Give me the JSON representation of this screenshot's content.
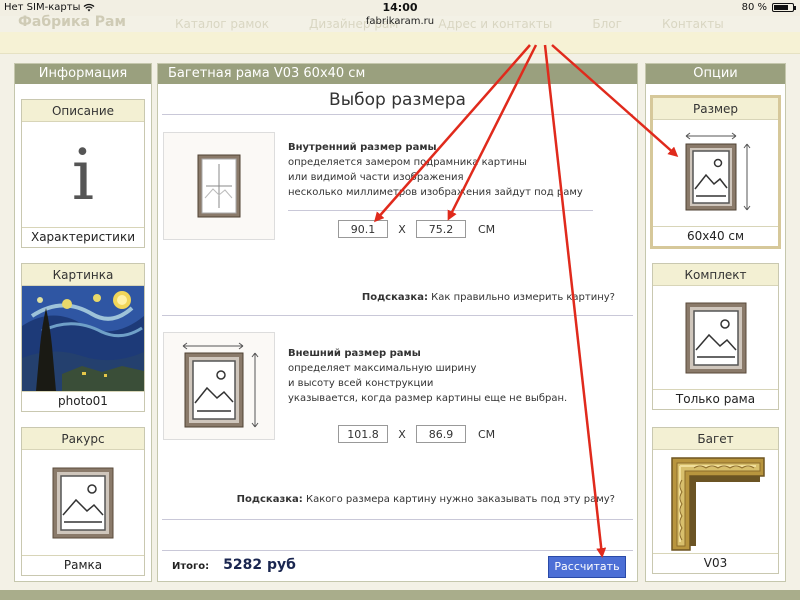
{
  "status_bar": {
    "carrier": "Нет SIM-карты",
    "time": "14:00",
    "battery": "80 %",
    "battery_level": 0.8
  },
  "browser": {
    "url": "fabrikaram.ru"
  },
  "site_nav": {
    "brand": "Фабрика Рам",
    "links": [
      "Каталог рамок",
      "Дизайнер рам",
      "Адрес и контакты",
      "Блог",
      "Контакты"
    ]
  },
  "left_panel": {
    "title": "Информация",
    "cards": [
      {
        "head": "Описание",
        "foot": "Характеристики",
        "glyph": "i"
      },
      {
        "head": "Картинка",
        "foot": "photo01"
      },
      {
        "head": "Ракурс",
        "foot": "Рамка"
      }
    ]
  },
  "center_panel": {
    "title": "Багетная рама V03 60х40 см",
    "heading": "Выбор размера",
    "inner": {
      "head": "Внутренний размер рамы",
      "lines": [
        "определяется замером подрамника картины",
        "или видимой части изображения",
        "несколько миллиметров изображения зайдут под раму"
      ],
      "width": "90.1",
      "height": "75.2",
      "sep": "X",
      "unit": "СМ",
      "hint_label": "Подсказка:",
      "hint_text": "Как правильно измерить картину?"
    },
    "outer": {
      "head": "Внешний размер рамы",
      "lines": [
        "определяет максимальную ширину",
        "и высоту всей конструкции",
        "указывается, когда размер картины еще не выбран."
      ],
      "width": "101.8",
      "height": "86.9",
      "sep": "X",
      "unit": "СМ",
      "hint_label": "Подсказка:",
      "hint_text": "Какого размера картину нужно заказывать под эту раму?"
    },
    "total_label": "Итого:",
    "total_value": "5282 руб",
    "calc_button": "Рассчитать"
  },
  "right_panel": {
    "title": "Опции",
    "cards": [
      {
        "head": "Размер",
        "foot": "60х40 см",
        "selected": true
      },
      {
        "head": "Комплект",
        "foot": "Только рама"
      },
      {
        "head": "Багет",
        "foot": "V03"
      }
    ]
  },
  "colors": {
    "panel_header": "#9aa07e",
    "card_header": "#f3f0d3",
    "button": "#4c6fd6",
    "arrow": "#e02a1c",
    "total": "#1a2650"
  },
  "icons": [
    "wifi-icon",
    "battery-icon",
    "info-icon",
    "framed-picture-icon",
    "starry-night-thumbnail",
    "frame-molding-icon",
    "arrow-annotation-icon"
  ]
}
